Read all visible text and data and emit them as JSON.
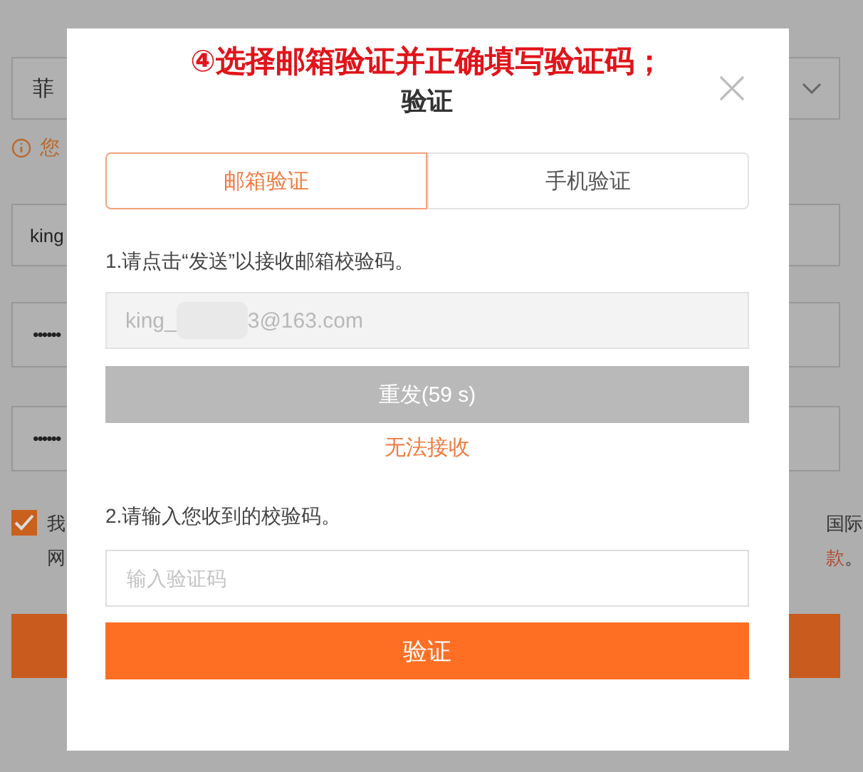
{
  "background_form": {
    "region_select": "菲",
    "notice": "您",
    "username": "king",
    "password_mask": "••••••",
    "confirm_mask": "••••••",
    "agreement": {
      "checked": true,
      "left_line_1": "我",
      "left_line_2": "网",
      "right_line_1": "国际",
      "right_link": "款",
      "right_tail": "。"
    }
  },
  "dialog": {
    "annotation": "④选择邮箱验证并正确填写验证码；",
    "title": "验证",
    "tabs": [
      {
        "label": "邮箱验证",
        "selected": true
      },
      {
        "label": "手机验证",
        "selected": false
      }
    ],
    "step_1": "1.请点击“发送”以接收邮箱校验码。",
    "email_field": {
      "value_start": "king_",
      "value_end": "3@163.com",
      "redacted": true
    },
    "resend_button": {
      "label": "重发(59 s)",
      "disabled": true
    },
    "help_link": "无法接收",
    "step_2": "2.请输入您收到的校验码。",
    "code_field": {
      "placeholder": "输入验证码"
    },
    "verify_button": "验证"
  }
}
